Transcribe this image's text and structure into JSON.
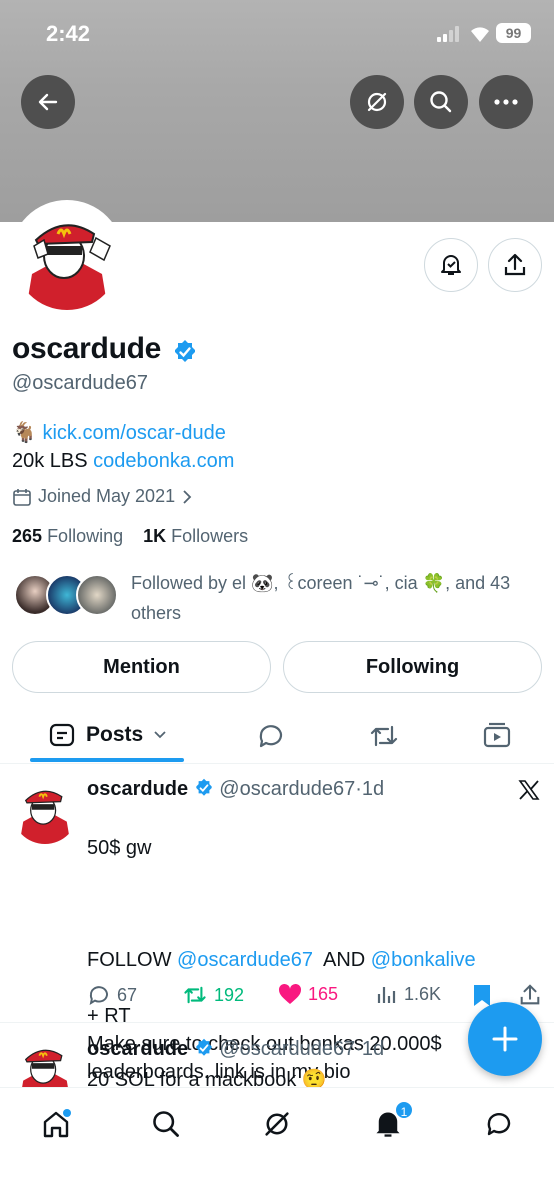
{
  "status": {
    "time": "2:42",
    "battery": "99"
  },
  "profile": {
    "name": "oscardude",
    "handle": "@oscardude67",
    "bio_link1": "kick.com/oscar-dude",
    "bio_line2_text": "20k LBS ",
    "bio_link2": "codebonka.com",
    "joined": "Joined May 2021",
    "following_count": "265",
    "following_label": "Following",
    "followers_count": "1K",
    "followers_label": "Followers",
    "followed_by": "Followed by el 🐼, ꒰coreen ˙⊸˙, cia 🍀, and 43 others",
    "mention_label": "Mention",
    "following_button_label": "Following"
  },
  "tabs": {
    "posts_label": "Posts"
  },
  "tweet1": {
    "name": "oscardude",
    "handle": "@oscardude67",
    "time": "1d",
    "line1": "50$ gw",
    "follow_text": "FOLLOW ",
    "mention1": "@oscardude67",
    "and_text": "  AND ",
    "mention2": "@bonkalive",
    "rest": "+ RT\nMake sure to check out bonkas 20.000$\nleaderboards. link is in my bio",
    "replies": "67",
    "retweets": "192",
    "likes": "165",
    "views": "1.6K"
  },
  "tweet2": {
    "name": "oscardude",
    "handle": "@oscardude67",
    "time": "1d",
    "text": "20 SOL for a mackbook 🤨"
  },
  "nav": {
    "notification_badge": "1"
  },
  "colors": {
    "accent": "#1d9bf0",
    "like": "#f91880",
    "retweet": "#00ba7c"
  }
}
